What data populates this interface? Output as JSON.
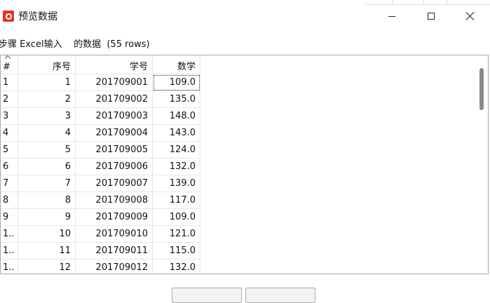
{
  "window": {
    "title": "预览数据",
    "minimize_label": "",
    "maximize_label": "",
    "close_label": ""
  },
  "subtitle": "步骤 Excel输入    的数据  (55 rows)",
  "table": {
    "columns": [
      "#",
      "序号",
      "学号",
      "数学"
    ],
    "rows": [
      [
        "1",
        "1",
        "201709001",
        "109.0"
      ],
      [
        "2",
        "2",
        "201709002",
        "135.0"
      ],
      [
        "3",
        "3",
        "201709003",
        "148.0"
      ],
      [
        "4",
        "4",
        "201709004",
        "143.0"
      ],
      [
        "5",
        "5",
        "201709005",
        "124.0"
      ],
      [
        "6",
        "6",
        "201709006",
        "132.0"
      ],
      [
        "7",
        "7",
        "201709007",
        "139.0"
      ],
      [
        "8",
        "8",
        "201709008",
        "117.0"
      ],
      [
        "9",
        "9",
        "201709009",
        "109.0"
      ],
      [
        "1..",
        "10",
        "201709010",
        "121.0"
      ],
      [
        "1..",
        "11",
        "201709011",
        "115.0"
      ],
      [
        "1..",
        "12",
        "201709012",
        "132.0"
      ]
    ]
  },
  "footer": {
    "button_1_label": "",
    "button_2_label": ""
  },
  "colors": {
    "app_icon": "#e3342f",
    "border": "#a9a9a9",
    "grid_line": "#e6e6e6",
    "scroll_thumb": "#8a8a8a"
  }
}
